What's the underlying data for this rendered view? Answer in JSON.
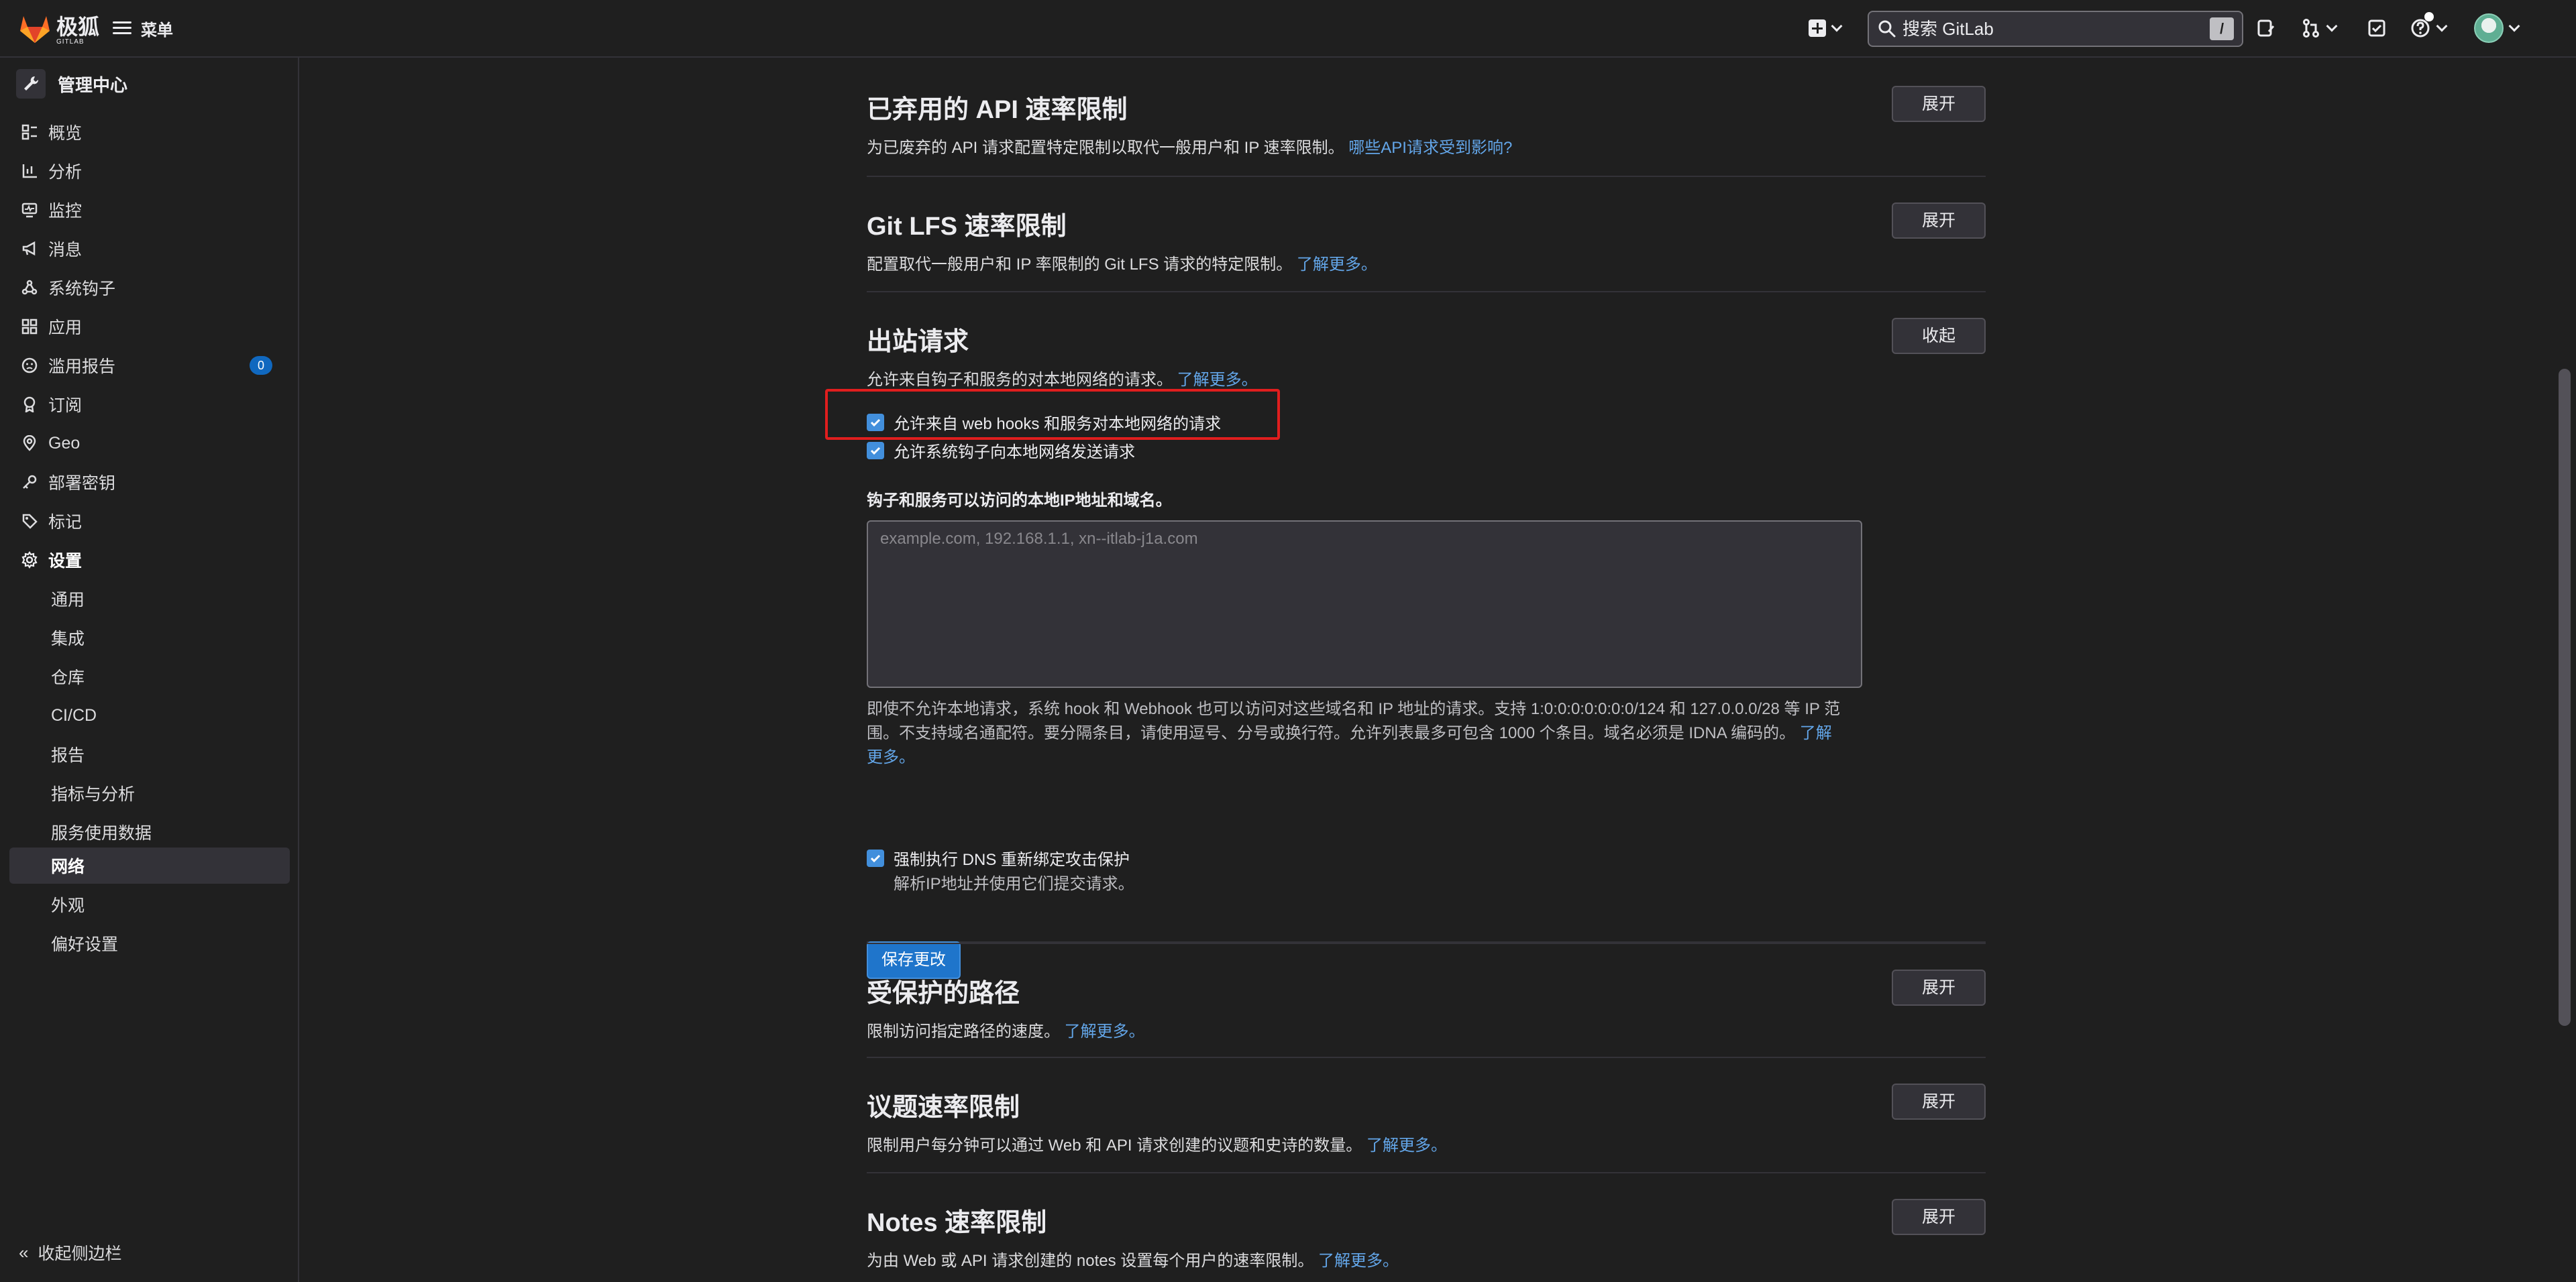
{
  "topbar": {
    "logo_cn": "极狐",
    "logo_en": "GITLAB",
    "menu_label": "菜单",
    "search_placeholder": "搜索 GitLab",
    "search_shortcut": "/"
  },
  "sidebar": {
    "title": "管理中心",
    "items": [
      {
        "label": "概览"
      },
      {
        "label": "分析"
      },
      {
        "label": "监控"
      },
      {
        "label": "消息"
      },
      {
        "label": "系统钩子"
      },
      {
        "label": "应用"
      },
      {
        "label": "滥用报告",
        "badge": "0"
      },
      {
        "label": "订阅"
      },
      {
        "label": "Geo"
      },
      {
        "label": "部署密钥"
      },
      {
        "label": "标记"
      },
      {
        "label": "设置"
      }
    ],
    "sub_items": [
      {
        "label": "通用"
      },
      {
        "label": "集成"
      },
      {
        "label": "仓库"
      },
      {
        "label": "CI/CD"
      },
      {
        "label": "报告"
      },
      {
        "label": "指标与分析"
      },
      {
        "label": "服务使用数据"
      },
      {
        "label": "网络"
      },
      {
        "label": "外观"
      },
      {
        "label": "偏好设置"
      }
    ],
    "collapse_label": "收起侧边栏"
  },
  "sections": {
    "deprecated_api": {
      "title": "已弃用的 API 速率限制",
      "desc": "为已废弃的 API 请求配置特定限制以取代一般用户和 IP 速率限制。",
      "link": "哪些API请求受到影响?",
      "button": "展开"
    },
    "git_lfs": {
      "title": "Git LFS 速率限制",
      "desc": "配置取代一般用户和 IP 率限制的 Git LFS 请求的特定限制。",
      "link": "了解更多。",
      "button": "展开"
    },
    "outbound": {
      "title": "出站请求",
      "desc": "允许来自钩子和服务的对本地网络的请求。",
      "link": "了解更多。",
      "button": "收起",
      "cb_webhooks": "允许来自 web hooks 和服务对本地网络的请求",
      "cb_system_hooks": "允许系统钩子向本地网络发送请求",
      "allowlist_label": "钩子和服务可以访问的本地IP地址和域名。",
      "allowlist_placeholder": "example.com, 192.168.1.1, xn--itlab-j1a.com",
      "help_line1": "即使不允许本地请求，系统 hook 和 Webhook 也可以访问对这些域名和 IP 地址的请求。支持 1:0:0:0:0:0:0:0/124 和 127.0.0.0/28 等 IP 范",
      "help_line2": "围。不支持域名通配符。要分隔条目，请使用逗号、分号或换行符。允许列表最多可包含 1000 个条目。域名必须是 IDNA 编码的。",
      "help_link_a": "了解",
      "help_link_b": "更多。",
      "cb_dns": "强制执行 DNS 重新绑定攻击保护",
      "cb_dns_help": "解析IP地址并使用它们提交请求。",
      "save_button": "保存更改"
    },
    "protected_paths": {
      "title": "受保护的路径",
      "desc": "限制访问指定路径的速度。",
      "link": "了解更多。",
      "button": "展开"
    },
    "issues_rate": {
      "title": "议题速率限制",
      "desc": "限制用户每分钟可以通过 Web 和 API 请求创建的议题和史诗的数量。",
      "link": "了解更多。",
      "button": "展开"
    },
    "notes_rate": {
      "title": "Notes 速率限制",
      "desc": "为由 Web 或 API 请求创建的 notes 设置每个用户的速率限制。",
      "link": "了解更多。",
      "button": "展开"
    }
  },
  "colors": {
    "accent": "#1f75cb",
    "link": "#63a6e9",
    "highlight": "#e01e1e",
    "badge": "#1068bf"
  }
}
